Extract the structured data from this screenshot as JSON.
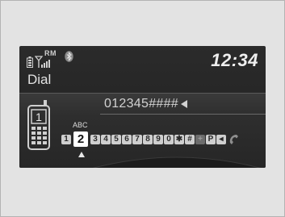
{
  "status": {
    "icons": [
      "battery-icon",
      "signal-strength-icon",
      "bluetooth-icon"
    ],
    "roam": "RM",
    "clock": "12:34"
  },
  "screen": {
    "title": "Dial",
    "dialed_number": "012345####"
  },
  "keypad": {
    "letters": "ABC",
    "keys": [
      "1",
      "2",
      "3",
      "4",
      "5",
      "6",
      "7",
      "8",
      "9",
      "0",
      "✱",
      "#",
      "+",
      "P",
      "◂"
    ],
    "selected": "2"
  },
  "colors": {
    "screen_bg": "#2b2b2b",
    "text": "#e2e2e2",
    "key_bg": "#cfcfcf"
  }
}
